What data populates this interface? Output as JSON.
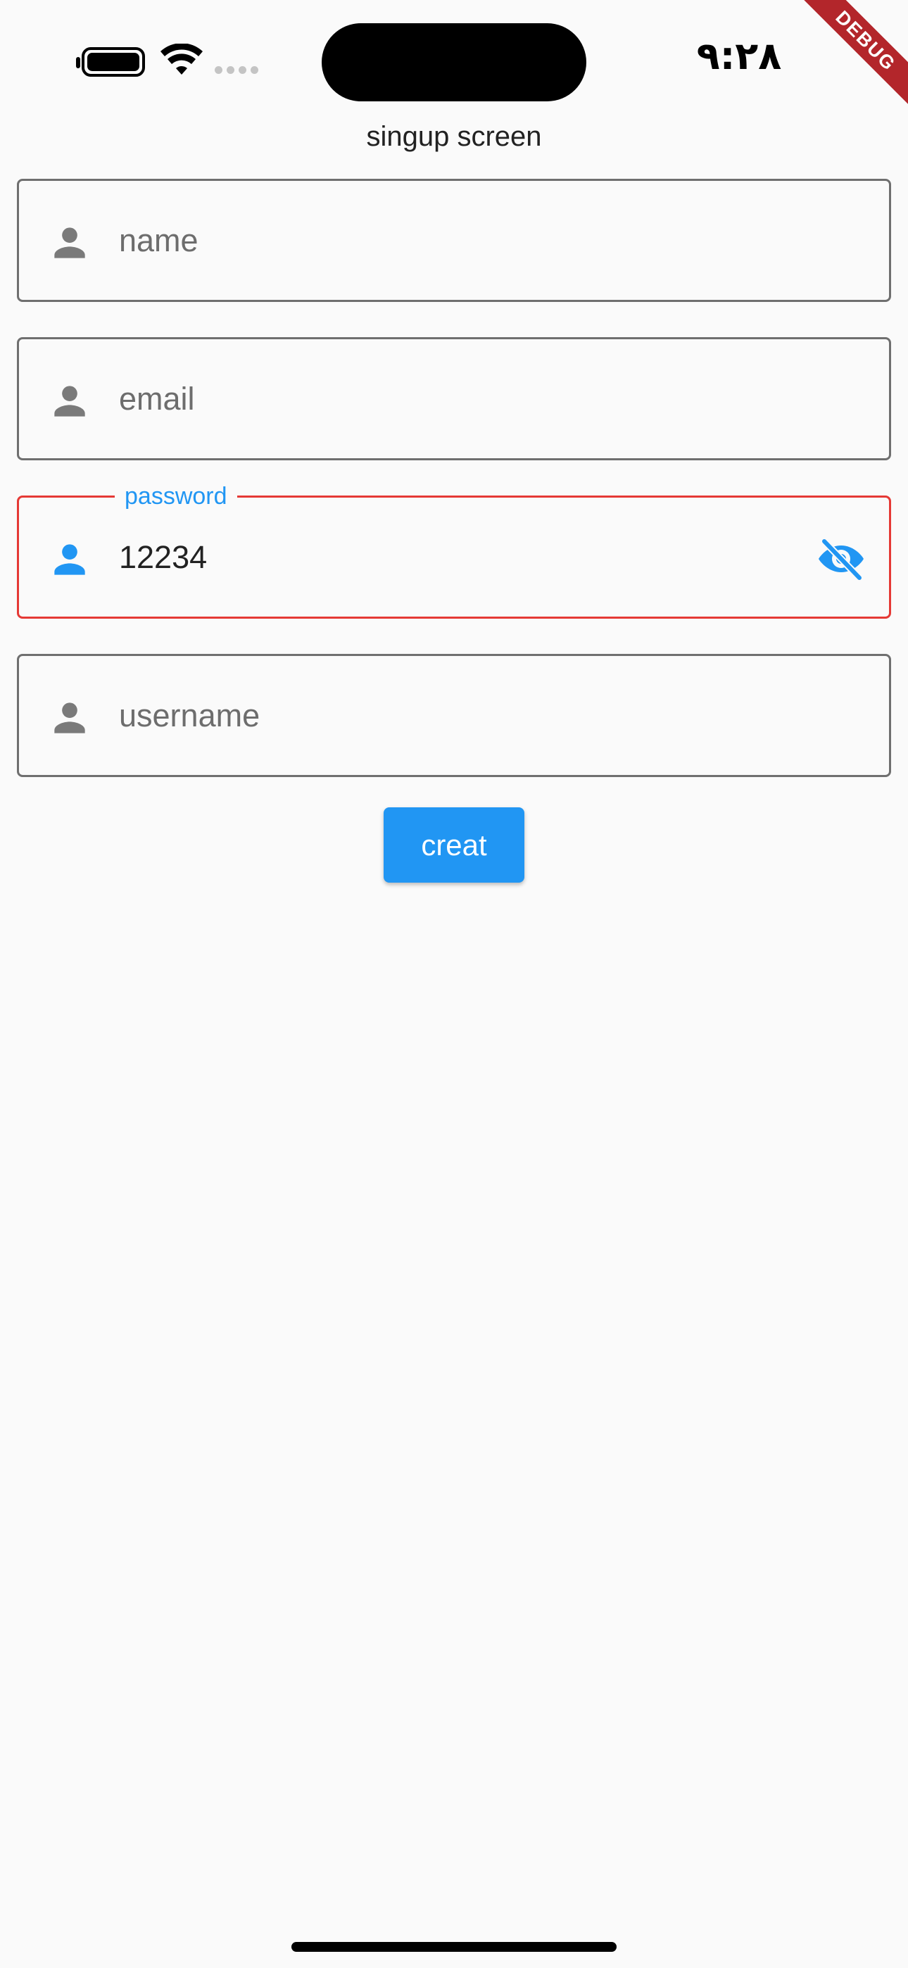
{
  "status_bar": {
    "time": "٩:٢٨"
  },
  "debug_banner": "DEBUG",
  "page": {
    "title": "singup screen"
  },
  "form": {
    "name": {
      "placeholder": "name",
      "icon": "person-icon"
    },
    "email": {
      "placeholder": "email",
      "icon": "person-icon"
    },
    "password": {
      "label": "password",
      "value": "12234",
      "icon": "person-icon",
      "toggle_icon": "visibility-off-icon",
      "state": "focused-error"
    },
    "username": {
      "placeholder": "username",
      "icon": "person-icon"
    }
  },
  "actions": {
    "create_label": "creat"
  },
  "colors": {
    "accent": "#2196f3",
    "error": "#e53935",
    "outline": "#6f6f6f",
    "debug": "#b3262b",
    "background": "#fafafa"
  }
}
